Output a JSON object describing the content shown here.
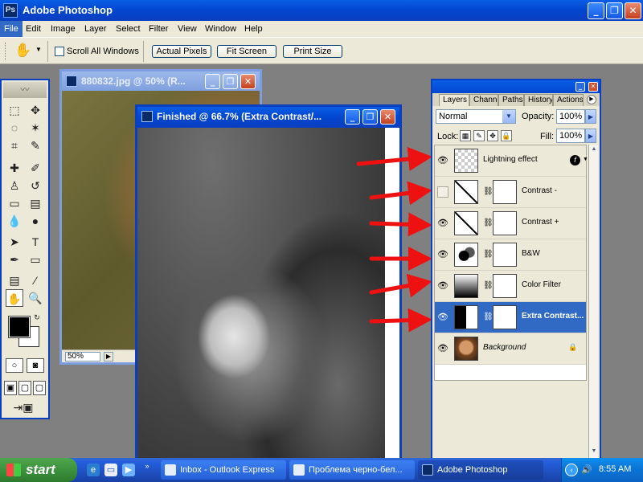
{
  "window": {
    "title": "Adobe Photoshop",
    "minimize": "_",
    "maximize": "❐",
    "close": "✕"
  },
  "menu": [
    "File",
    "Edit",
    "Image",
    "Layer",
    "Select",
    "Filter",
    "View",
    "Window",
    "Help"
  ],
  "options": {
    "scroll_all_windows": "Scroll All Windows",
    "actual_pixels": "Actual Pixels",
    "fit_screen": "Fit Screen",
    "print_size": "Print Size"
  },
  "documents": {
    "back": {
      "title": "880832.jpg @ 50% (R...",
      "zoom": "50%"
    },
    "front": {
      "title": "Finished @ 66.7% (Extra Contrast/..."
    }
  },
  "layers_panel": {
    "tabs": [
      "Layers",
      "Channels",
      "Paths",
      "History",
      "Actions"
    ],
    "blend_mode": "Normal",
    "opacity_label": "Opacity:",
    "opacity": "100%",
    "lock_label": "Lock:",
    "fill_label": "Fill:",
    "fill": "100%",
    "layers": [
      {
        "name": "Lightning effect",
        "visible": true,
        "thumb": "checker",
        "mask": false,
        "fx": true
      },
      {
        "name": "Contrast -",
        "visible": false,
        "thumb": "curves",
        "mask": true
      },
      {
        "name": "Contrast +",
        "visible": true,
        "thumb": "curves",
        "mask": true
      },
      {
        "name": "B&W",
        "visible": true,
        "thumb": "bw",
        "mask": true
      },
      {
        "name": "Color Filter",
        "visible": true,
        "thumb": "gradient",
        "mask": true
      },
      {
        "name": "Extra Contrast...",
        "visible": true,
        "thumb": "contrast",
        "mask": true,
        "selected": true
      },
      {
        "name": "Background",
        "visible": true,
        "thumb": "photo",
        "mask": false,
        "locked": true
      }
    ]
  },
  "taskbar": {
    "start": "start",
    "buttons": [
      "Inbox - Outlook Express",
      "Проблема черно-бел...",
      "Adobe Photoshop"
    ],
    "time": "8:55 AM"
  },
  "icons": {
    "hand_tool": "hand-icon",
    "eye": "eye-icon",
    "link": "chain-icon",
    "lock": "padlock-icon"
  },
  "colors": {
    "title_blue": "#0346d0",
    "arrow_red": "#ee1111",
    "selected_row": "#316ac5"
  }
}
